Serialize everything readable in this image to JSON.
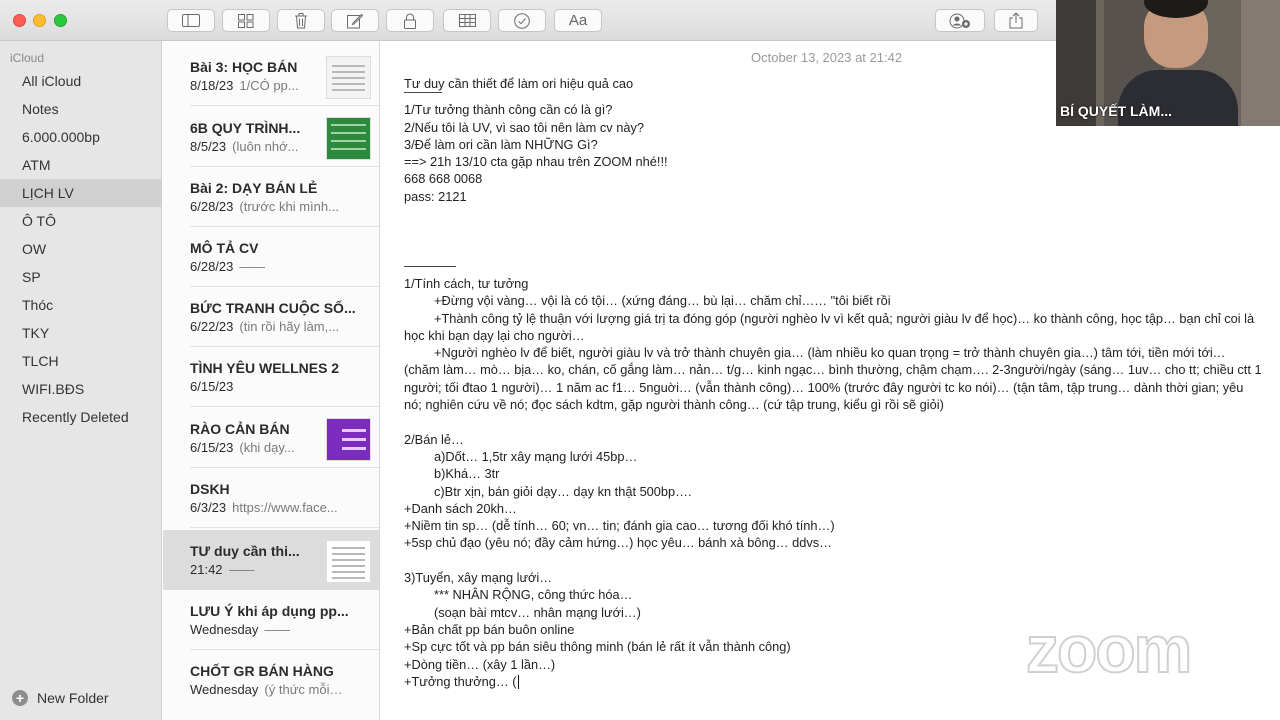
{
  "toolbar": {
    "buttons": [
      "sidebar-toggle-icon",
      "gallery-view-icon",
      "trash-icon",
      "compose-icon",
      "lock-icon",
      "table-icon",
      "checklist-icon",
      "format-text-icon",
      "add-people-icon",
      "share-icon"
    ],
    "format_label": "Aa"
  },
  "sidebar": {
    "account": "iCloud",
    "items": [
      {
        "label": "All iCloud"
      },
      {
        "label": "Notes"
      },
      {
        "label": "6.000.000bp"
      },
      {
        "label": "ATM"
      },
      {
        "label": "LỊCH LV",
        "selected": true
      },
      {
        "label": "Ô TÔ"
      },
      {
        "label": "OW"
      },
      {
        "label": "SP"
      },
      {
        "label": "Thóc"
      },
      {
        "label": "TKY"
      },
      {
        "label": "TLCH"
      },
      {
        "label": "WIFI.BĐS"
      },
      {
        "label": "Recently Deleted"
      }
    ],
    "new_folder": "New Folder"
  },
  "notes": [
    {
      "title": "Bài 3: HỌC BÁN",
      "date": "8/18/23",
      "preview": "1/CÓ pp..."
    },
    {
      "title": "6B QUY TRÌNH...",
      "date": "8/5/23",
      "preview": "(luôn nhớ..."
    },
    {
      "title": "Bài 2: DẠY BÁN LẺ",
      "date": "6/28/23",
      "preview": "(trước khi mình..."
    },
    {
      "title": "MÔ TẢ CV",
      "date": "6/28/23",
      "preview": "——"
    },
    {
      "title": "BỨC TRANH CUỘC SỐ...",
      "date": "6/22/23",
      "preview": "(tin rồi hãy làm,..."
    },
    {
      "title": "TÌNH YÊU WELLNES 2",
      "date": "6/15/23",
      "preview": ""
    },
    {
      "title": "RÀO CẢN BÁN",
      "date": "6/15/23",
      "preview": "(khi dạy..."
    },
    {
      "title": "DSKH",
      "date": "6/3/23",
      "preview": "https://www.face..."
    },
    {
      "title": "TƯ duy cần thi...",
      "date": "21:42",
      "preview": "——",
      "selected": true
    },
    {
      "title": "LƯU Ý khi áp dụng pp...",
      "date": "Wednesday",
      "preview": "——"
    },
    {
      "title": "CHỐT GR BÁN HÀNG",
      "date": "Wednesday",
      "preview": "(ý thức mỗi n..."
    }
  ],
  "editor": {
    "date": "October 13, 2023 at 21:42",
    "title": "Tư duy cần thiết để làm ori hiệu quả cao",
    "q1": "1/Tư tưởng thành công cần có là gì?",
    "q2": "2/Nếu tôi là UV, vì sao tôi nên làm cv này?",
    "q3": "3/Để làm ori cần làm NHỮNG Gì?",
    "zoom_line": "==> 21h 13/10 cta gặp nhau trên ZOOM nhé!!!",
    "zoom_id": "668 668 0068",
    "zoom_pass": "pass: 2121",
    "s1_head": "1/Tính cách, tư tưởng",
    "s1_a": "+Đừng vội vàng… vội là có tội… (xứng đáng… bù lại… chăm chỉ…… \"tôi biết rồi",
    "s1_b": "+Thành công tỷ lệ thuận với lượng giá trị ta đóng góp (người nghèo lv vì kết quả; người giàu lv để học)… ko thành công, học tập… bạn chỉ coi là học khi bạn dạy lại cho người…",
    "s1_c": "+Người nghèo lv để biết, người giàu lv và trở thành chuyên gia… (làm nhiều ko quan trọng = trở thành chuyên gia…) tâm tới, tiền mới tới… (chăm làm… mò… bịa… ko, chán, cố gắng làm… nản… t/g… kinh ngạc… bình thường, chậm chạm…. 2-3người/ngày (sáng… 1uv… cho tt; chiều ctt 1 người; tối đtao 1 người)… 1 năm ac f1… 5nguời… (vẫn thành công)… 100% (trước đây người tc ko nói)… (tận tâm, tập trung… dành thời gian; yêu nó; nghiên cứu về nó; đọc sách kdtm, gặp người thành công… (cứ tập trung, kiểu gì rồi sẽ giỏi)",
    "s2_head": "2/Bán lẻ…",
    "s2_a": "a)Dốt… 1,5tr xây mạng lưới 45bp…",
    "s2_b": "b)Khá… 3tr",
    "s2_c": "c)Btr xịn, bán giỏi dạy… dạy kn thật 500bp….",
    "s2_d": "+Danh sách 20kh…",
    "s2_e": "+Niềm tin sp… (dễ tính… 60; vn… tin; đánh gia cao… tương đối khó tính…)",
    "s2_f": "+5sp chủ đạo (yêu nó; đầy cảm hứng…) học yêu… bánh xà bông… ddvs…",
    "s3_head": "3)Tuyển, xây mạng lưới…",
    "s3_a": "*** NHÂN RỘNG, công thức hóa…",
    "s3_b": "(soạn bài mtcv… nhân mạng lưới…)",
    "s3_c": "+Bản chất pp bán buôn online",
    "s3_d": "+Sp cực tốt và pp bán siêu thông minh (bán lẻ rất ít vẫn thành công)",
    "s3_e": "+Dòng tiền… (xây 1 lần…)",
    "s3_f": "+Tưởng thưởng… ("
  },
  "video": {
    "participant_name": "BÍ QUYẾT LÀM..."
  },
  "watermark": "zoom"
}
